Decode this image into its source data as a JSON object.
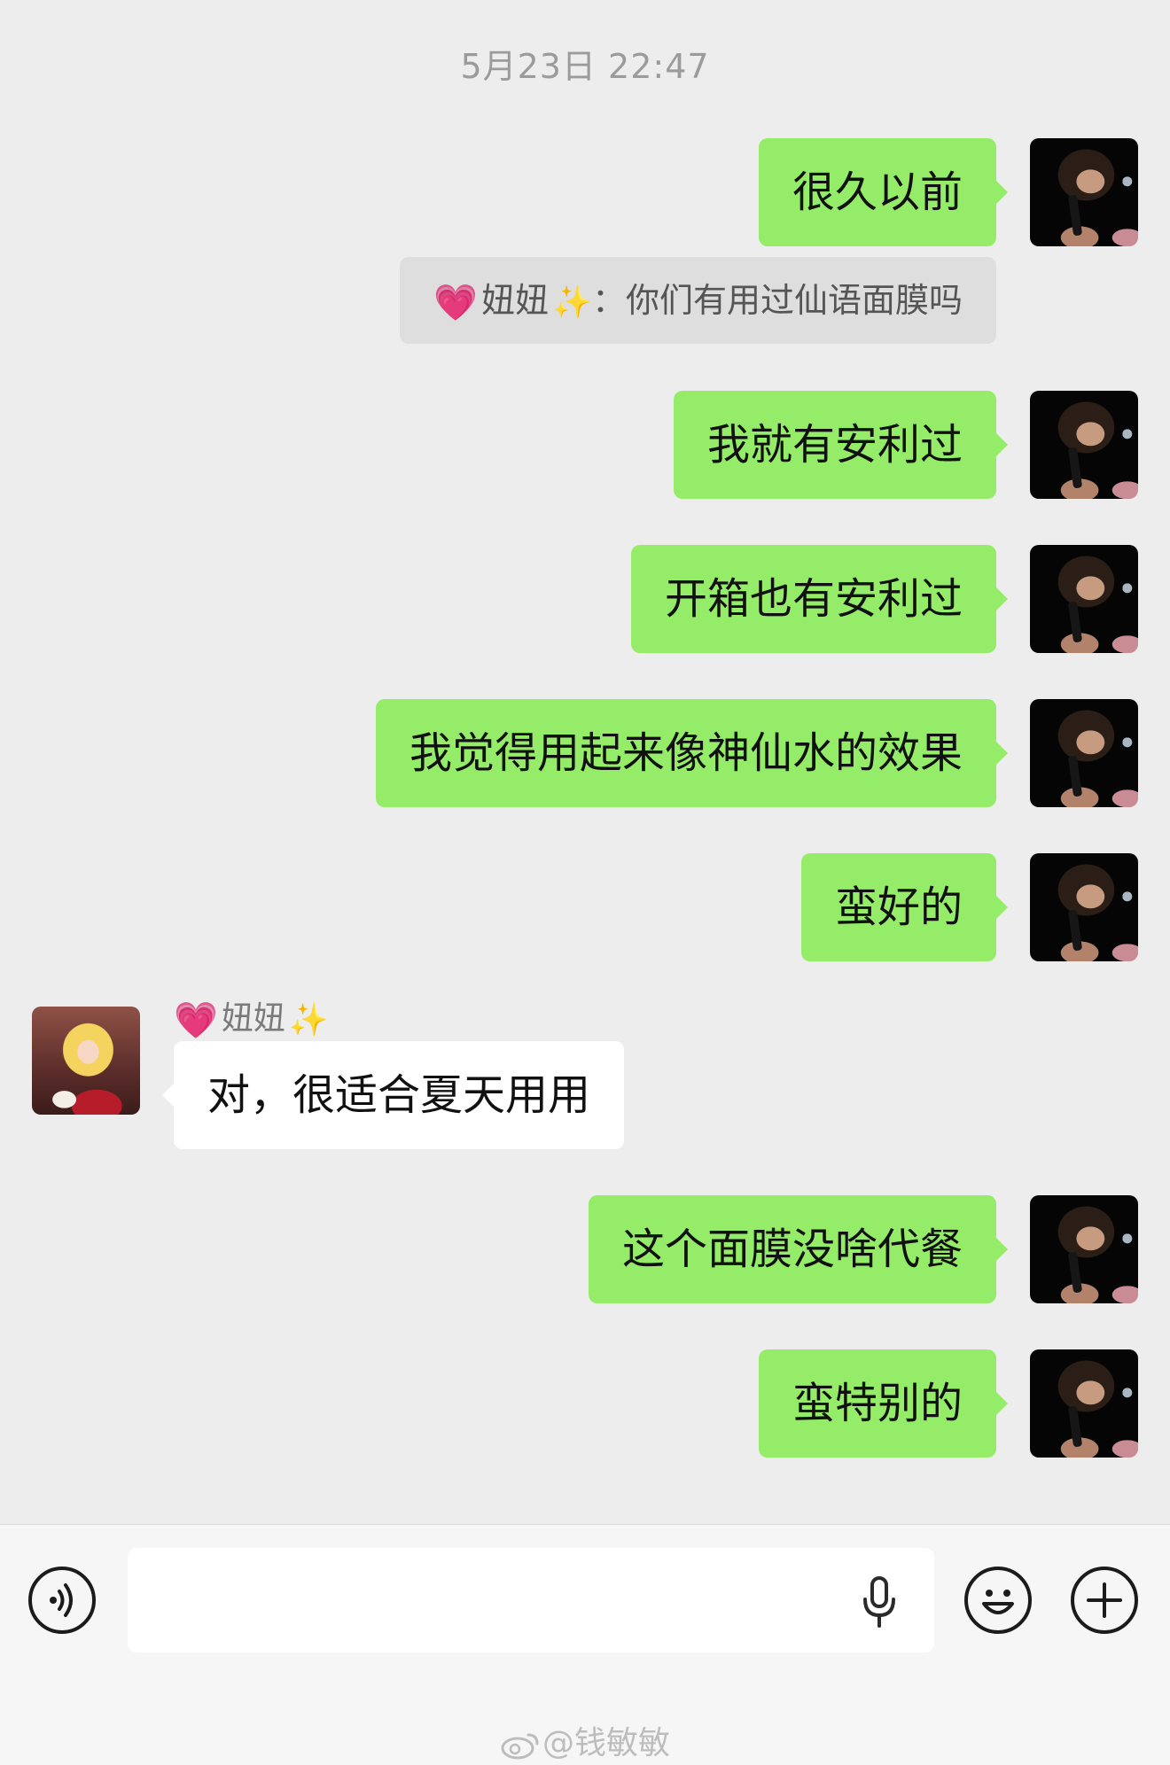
{
  "timestamp": "5月23日 22:47",
  "messages": [
    {
      "text": "很久以前"
    },
    {
      "text": "我就有安利过"
    },
    {
      "text": "开箱也有安利过"
    },
    {
      "text": "我觉得用起来像神仙水的效果"
    },
    {
      "text": "蛮好的"
    },
    {
      "text": "对，很适合夏天用用"
    },
    {
      "text": "这个面膜没啥代餐"
    },
    {
      "text": "蛮特别的"
    }
  ],
  "quote": {
    "sender": "妞妞",
    "separator": "：",
    "text": "你们有用过仙语面膜吗"
  },
  "sender": {
    "name": "妞妞"
  },
  "icons": {
    "heart": "💗",
    "sparkle": "✨",
    "voice": "voice-icon",
    "mic": "mic-icon",
    "emoji": "emoji-icon",
    "plus": "plus-icon"
  },
  "watermark": "@钱敏敏",
  "colors": {
    "background": "#ededed",
    "outgoing_bubble": "#95ec69",
    "incoming_bubble": "#ffffff",
    "quote_bubble": "#dedede"
  }
}
